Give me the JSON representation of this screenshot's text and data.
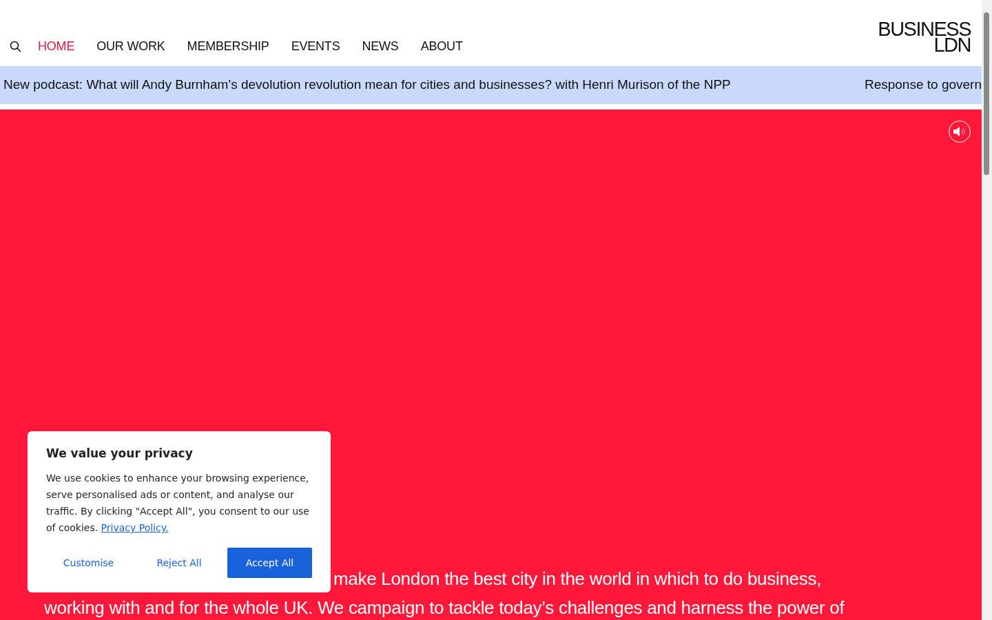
{
  "header": {
    "logo": [
      "BUSINESS",
      "LDN"
    ],
    "nav": [
      {
        "label": "HOME",
        "selected": true
      },
      {
        "label": "OUR WORK",
        "selected": false
      },
      {
        "label": "MEMBERSHIP",
        "selected": false
      },
      {
        "label": "EVENTS",
        "selected": false
      },
      {
        "label": "NEWS",
        "selected": false
      },
      {
        "label": "ABOUT",
        "selected": false
      }
    ]
  },
  "ticker": [
    "New podcast: What will Andy Burnham’s devolution revolution mean for cities and businesses? with Henri Murison of the NPP",
    "Response to govern"
  ],
  "hero": {
    "lines": [
      "make London the best city in the world in which to do business,",
      "working with and for the whole UK. We campaign to tackle today’s challenges and harness the power of"
    ]
  },
  "cookie_banner": {
    "title": "We value your privacy",
    "text": "We use cookies to enhance your browsing experience, serve personalised ads or content, and analyse our traffic. By clicking \"Accept All\", you consent to our use of cookies.",
    "link": "Privacy Policy.",
    "buttons": [
      {
        "label": "Customise",
        "kind": "link"
      },
      {
        "label": "Reject All",
        "kind": "link"
      },
      {
        "label": "Accept All",
        "kind": "primary"
      }
    ]
  }
}
